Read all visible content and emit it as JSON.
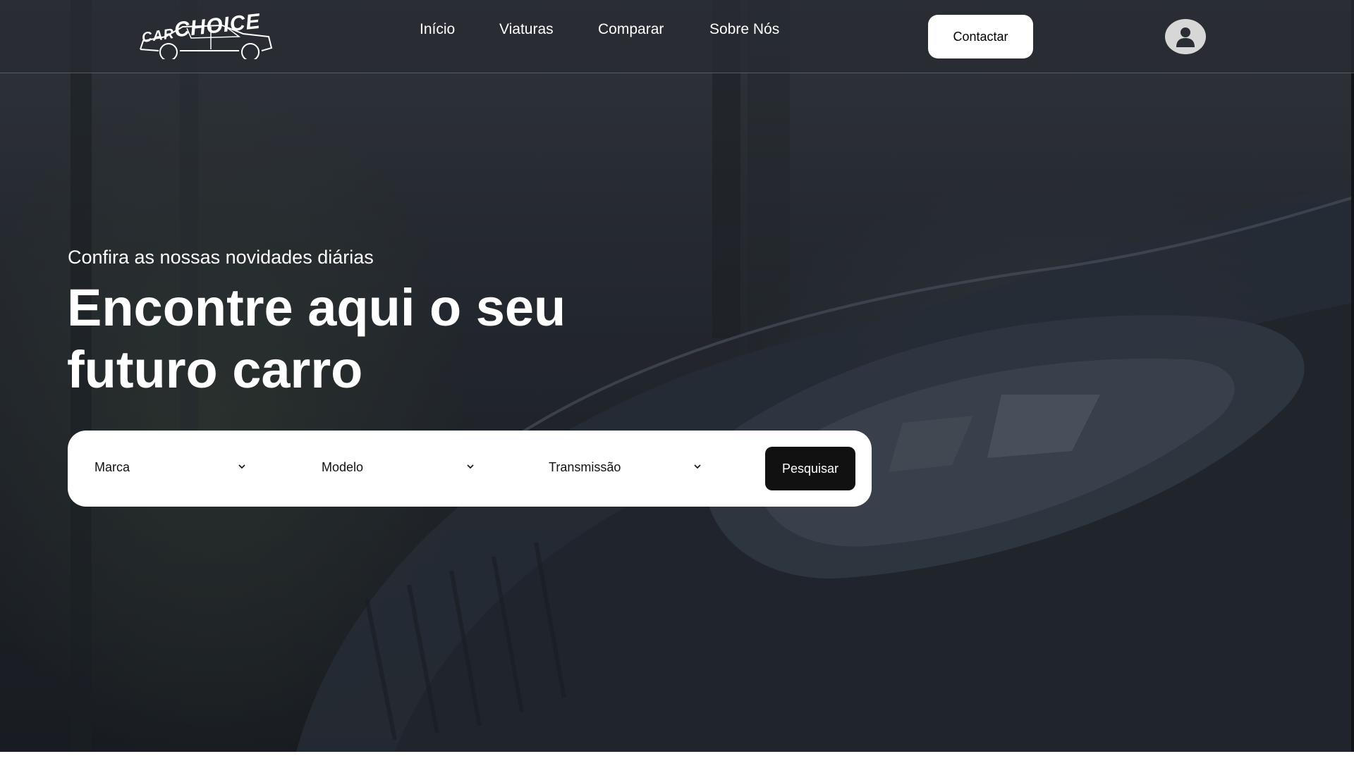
{
  "brand": {
    "logo_text_small": "CAR",
    "logo_text_large": "CHOICE"
  },
  "nav": {
    "items": [
      {
        "label": "Início"
      },
      {
        "label": "Viaturas"
      },
      {
        "label": "Comparar"
      },
      {
        "label": "Sobre Nós"
      }
    ],
    "contact_label": "Contactar",
    "account_icon": "user-icon"
  },
  "hero": {
    "subtitle": "Confira as nossas novidades diárias",
    "headline_line1": "Encontre aqui o seu",
    "headline_line2": "futuro carro"
  },
  "search": {
    "brand_select": "Marca",
    "model_select": "Modelo",
    "transmission_select": "Transmissão",
    "submit_label": "Pesquisar",
    "chevron_icon": "chevron-down-icon"
  },
  "colors": {
    "header_bg": "#2c3036",
    "primary_button": "#111111",
    "panel_bg": "#ffffff",
    "text_light": "#ffffff"
  }
}
